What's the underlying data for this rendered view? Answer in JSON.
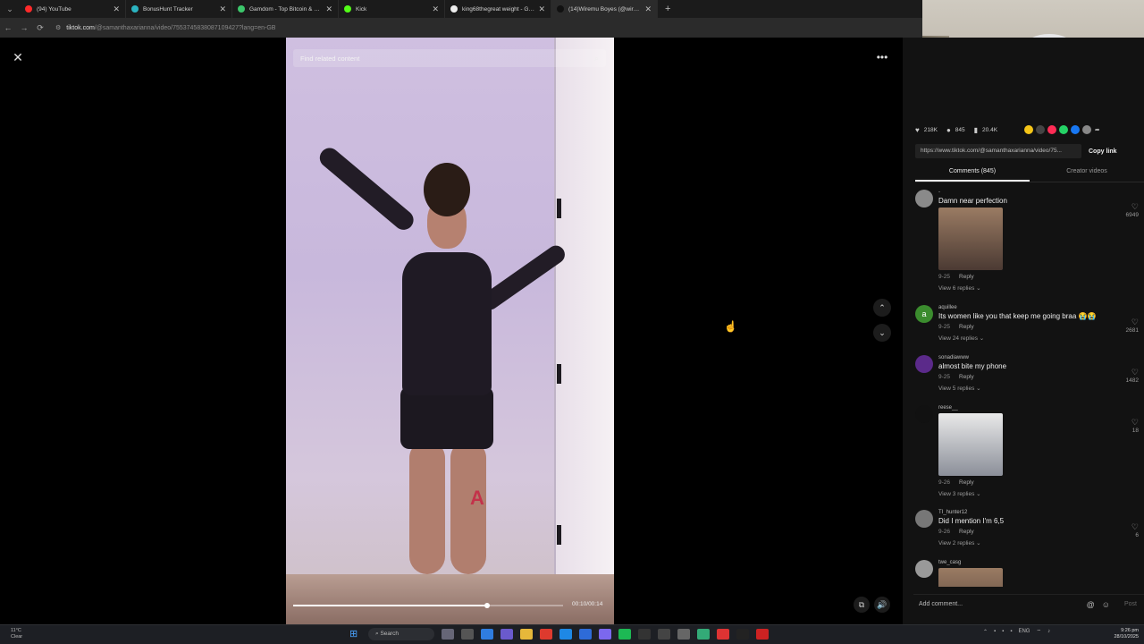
{
  "browser": {
    "tabs": [
      {
        "title": "(94) YouTube",
        "color": "#ff2a2a"
      },
      {
        "title": "BonusHunt Tracker",
        "color": "#2bb3c0"
      },
      {
        "title": "Gamdom - Top Bitcoin & Crypto",
        "color": "#3cc76b"
      },
      {
        "title": "Kick",
        "color": "#53fc18"
      },
      {
        "title": "king68thegreat weight - Google",
        "color": "#eeeeee"
      },
      {
        "title": "(14)Wiremu Boyes (@wire...",
        "color": "#111111",
        "active": true
      }
    ],
    "url_host": "tiktok.com",
    "url_path": "/@samanthaxarianna/video/7553745838087109427?lang=en-GB"
  },
  "video": {
    "search_placeholder": "Find related content",
    "timecode": "00:10/00:14",
    "progress_fraction": 0.72
  },
  "panel": {
    "likes": "218K",
    "comments_count": "845",
    "saves": "20.4K",
    "share_colors": [
      "#f5c518",
      "#444444",
      "#fe2c55",
      "#25d366",
      "#1877f2",
      "#888888"
    ],
    "link": "https://www.tiktok.com/@samanthaxarianna/video/75...",
    "copy_link": "Copy link",
    "tab_comments": "Comments (845)",
    "tab_creator": "Creator videos"
  },
  "comments": [
    {
      "user": "-",
      "text": "Damn near perfection",
      "date": "9-25",
      "reply": "Reply",
      "replies": "View 6 replies",
      "likes": "6949",
      "has_image": true,
      "avatar_color": "#8a8a8a"
    },
    {
      "user": "aquillee",
      "text": "Its women like you that keep me going braa 😭😭",
      "date": "9-25",
      "reply": "Reply",
      "replies": "View 24 replies",
      "likes": "2681",
      "has_image": false,
      "avatar_color": "#3b8c2e",
      "avatar_letter": "a"
    },
    {
      "user": "sonadiawww",
      "text": "almost bite my phone",
      "date": "9-25",
      "reply": "Reply",
      "replies": "View 5 replies",
      "likes": "1482",
      "has_image": false,
      "avatar_color": "#5b2a8a"
    },
    {
      "user": "reese__",
      "text": "",
      "date": "9-26",
      "reply": "Reply",
      "replies": "View 3 replies",
      "likes": "18",
      "has_image": true,
      "avatar_color": "#111111"
    },
    {
      "user": "TI_hunter12",
      "text": "Did I mention I'm 6,5",
      "date": "9-26",
      "reply": "Reply",
      "replies": "View 2 replies",
      "likes": "6",
      "has_image": false,
      "avatar_color": "#777777"
    },
    {
      "user": "twe_casg",
      "text": "",
      "date": "",
      "reply": "",
      "replies": "",
      "likes": "",
      "has_image": true,
      "avatar_color": "#999999"
    }
  ],
  "composer": {
    "placeholder": "Add comment...",
    "post": "Post"
  },
  "taskbar": {
    "weather_temp": "11°C",
    "weather_cond": "Clear",
    "search": "Search",
    "lang": "ENG",
    "time": "9:26 pm",
    "date": "28/10/2025"
  }
}
